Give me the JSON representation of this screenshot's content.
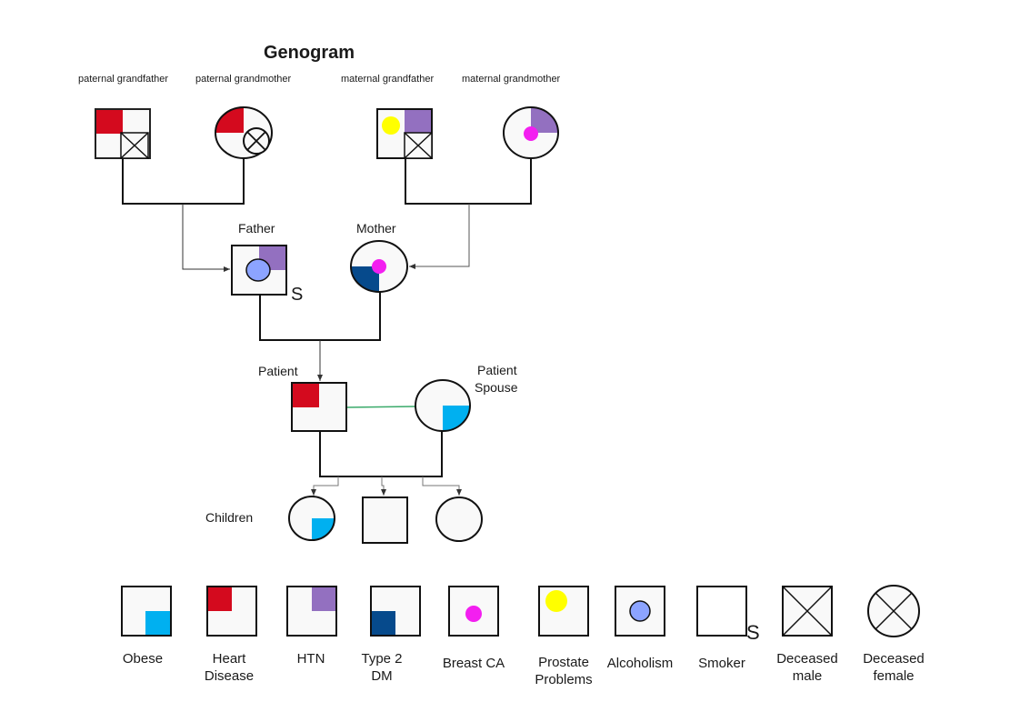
{
  "title": "Genogram",
  "colors": {
    "obese": "#00b0f0",
    "heart_disease": "#d40a1e",
    "htn": "#9370c0",
    "type2_dm": "#064a8c",
    "breast_ca": "#f31ff0",
    "prostate": "#ffff00",
    "alcoholism": "#8ca4ff",
    "marriage_line": "#3aaa6a",
    "fill": "#f9f9f9"
  },
  "people": {
    "paternal_grandfather": {
      "label": "paternal grandfather",
      "sex": "male",
      "conditions": [
        "Heart Disease"
      ],
      "deceased": true
    },
    "paternal_grandmother": {
      "label": "paternal grandmother",
      "sex": "female",
      "conditions": [
        "Heart Disease"
      ],
      "deceased": true
    },
    "maternal_grandfather": {
      "label": "maternal grandfather",
      "sex": "male",
      "conditions": [
        "Prostate Problems",
        "HTN"
      ],
      "deceased": true
    },
    "maternal_grandmother": {
      "label": "maternal grandmother",
      "sex": "female",
      "conditions": [
        "HTN",
        "Breast CA"
      ],
      "deceased": false
    },
    "father": {
      "label": "Father",
      "sex": "male",
      "conditions": [
        "HTN",
        "Alcoholism",
        "Smoker"
      ],
      "smoker_mark": "S"
    },
    "mother": {
      "label": "Mother",
      "sex": "female",
      "conditions": [
        "Type 2 DM",
        "Breast CA"
      ]
    },
    "patient": {
      "label": "Patient",
      "sex": "male",
      "conditions": [
        "Heart Disease"
      ]
    },
    "spouse": {
      "label_line1": "Patient",
      "label_line2": "Spouse",
      "sex": "female",
      "conditions": [
        "Obese"
      ]
    },
    "children_label": "Children",
    "children": [
      {
        "sex": "female",
        "conditions": [
          "Obese"
        ]
      },
      {
        "sex": "male",
        "conditions": []
      },
      {
        "sex": "female",
        "conditions": []
      }
    ]
  },
  "legend": [
    {
      "key": "obese",
      "line1": "Obese",
      "line2": ""
    },
    {
      "key": "heart_disease",
      "line1": "Heart",
      "line2": "Disease"
    },
    {
      "key": "htn",
      "line1": "HTN",
      "line2": ""
    },
    {
      "key": "type2_dm",
      "line1": "Type 2",
      "line2": "DM"
    },
    {
      "key": "breast_ca",
      "line1": "Breast CA",
      "line2": ""
    },
    {
      "key": "prostate",
      "line1": "Prostate",
      "line2": "Problems"
    },
    {
      "key": "alcoholism",
      "line1": "Alcoholism",
      "line2": ""
    },
    {
      "key": "smoker",
      "line1": "Smoker",
      "line2": "",
      "mark": "S"
    },
    {
      "key": "deceased_male",
      "line1": "Deceased",
      "line2": "male"
    },
    {
      "key": "deceased_female",
      "line1": "Deceased",
      "line2": "female"
    }
  ]
}
